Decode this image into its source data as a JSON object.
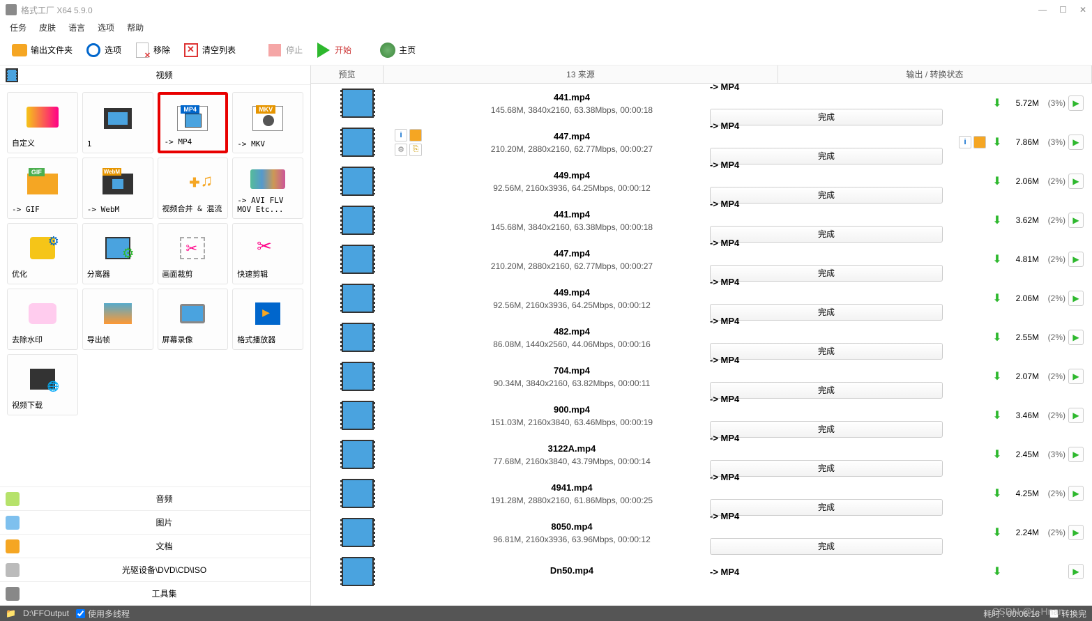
{
  "window": {
    "title": "格式工厂 X64 5.9.0"
  },
  "menu": [
    "任务",
    "皮肤",
    "语言",
    "选项",
    "帮助"
  ],
  "toolbar": {
    "output": "输出文件夹",
    "options": "选项",
    "remove": "移除",
    "clear": "清空列表",
    "stop": "停止",
    "start": "开始",
    "home": "主页"
  },
  "left": {
    "video_header": "视频",
    "tiles": [
      {
        "id": "custom",
        "label": "自定义",
        "art": "art-custom"
      },
      {
        "id": "clap",
        "label": "1",
        "art": "art-clap"
      },
      {
        "id": "mp4",
        "label": "-> MP4",
        "art": "art-mp4",
        "highlight": true
      },
      {
        "id": "mkv",
        "label": "-> MKV",
        "art": "art-mkv"
      },
      {
        "id": "gif",
        "label": "-> GIF",
        "art": "art-gif"
      },
      {
        "id": "webm",
        "label": "-> WebM",
        "art": "art-webm"
      },
      {
        "id": "merge",
        "label": "视频合并 & 混流",
        "art": "art-merge"
      },
      {
        "id": "blank1",
        "label": "",
        "art": "",
        "hidden": true
      },
      {
        "id": "avi",
        "label": "-> AVI FLV MOV Etc...",
        "art": "art-avi"
      },
      {
        "id": "opt",
        "label": "优化",
        "art": "art-opt"
      },
      {
        "id": "split",
        "label": "分离器",
        "art": "art-split"
      },
      {
        "id": "crop",
        "label": "画面裁剪",
        "art": "art-crop"
      },
      {
        "id": "cut",
        "label": "快速剪辑",
        "art": "art-cut"
      },
      {
        "id": "logo",
        "label": "去除水印",
        "art": "art-logo"
      },
      {
        "id": "export",
        "label": "导出帧",
        "art": "art-export"
      },
      {
        "id": "screen",
        "label": "屏幕录像",
        "art": "art-screen"
      },
      {
        "id": "player",
        "label": "格式播放器",
        "art": "art-player"
      },
      {
        "id": "dl",
        "label": "视频下载",
        "art": "art-dl"
      }
    ],
    "bottom": [
      {
        "id": "audio",
        "label": "音频",
        "color": "#b6e26b"
      },
      {
        "id": "image",
        "label": "图片",
        "color": "#7ec0ee"
      },
      {
        "id": "doc",
        "label": "文档",
        "color": "#f5a623"
      },
      {
        "id": "disc",
        "label": "光驱设备\\DVD\\CD\\ISO",
        "color": "#bbb"
      },
      {
        "id": "tools",
        "label": "工具集",
        "color": "#888"
      }
    ]
  },
  "list": {
    "headers": {
      "preview": "预览",
      "source": "13 来源",
      "status": "输出 / 转换状态"
    },
    "done_label": "完成",
    "rows": [
      {
        "name": "441.mp4",
        "info": "145.68M, 3840x2160, 63.38Mbps, 00:00:18",
        "out": "-> MP4",
        "size": "5.72M",
        "pct": "(3%)"
      },
      {
        "name": "447.mp4",
        "info": "210.20M, 2880x2160, 62.77Mbps, 00:00:27",
        "out": "-> MP4",
        "size": "7.86M",
        "pct": "(3%)",
        "badges": true,
        "extra": true
      },
      {
        "name": "449.mp4",
        "info": "92.56M, 2160x3936, 64.25Mbps, 00:00:12",
        "out": "-> MP4",
        "size": "2.06M",
        "pct": "(2%)"
      },
      {
        "name": "441.mp4",
        "info": "145.68M, 3840x2160, 63.38Mbps, 00:00:18",
        "out": "-> MP4",
        "size": "3.62M",
        "pct": "(2%)"
      },
      {
        "name": "447.mp4",
        "info": "210.20M, 2880x2160, 62.77Mbps, 00:00:27",
        "out": "-> MP4",
        "size": "4.81M",
        "pct": "(2%)"
      },
      {
        "name": "449.mp4",
        "info": "92.56M, 2160x3936, 64.25Mbps, 00:00:12",
        "out": "-> MP4",
        "size": "2.06M",
        "pct": "(2%)"
      },
      {
        "name": "482.mp4",
        "info": "86.08M, 1440x2560, 44.06Mbps, 00:00:16",
        "out": "-> MP4",
        "size": "2.55M",
        "pct": "(2%)"
      },
      {
        "name": "704.mp4",
        "info": "90.34M, 3840x2160, 63.82Mbps, 00:00:11",
        "out": "-> MP4",
        "size": "2.07M",
        "pct": "(2%)"
      },
      {
        "name": "900.mp4",
        "info": "151.03M, 2160x3840, 63.46Mbps, 00:00:19",
        "out": "-> MP4",
        "size": "3.46M",
        "pct": "(2%)"
      },
      {
        "name": "3122A.mp4",
        "info": "77.68M, 2160x3840, 43.79Mbps, 00:00:14",
        "out": "-> MP4",
        "size": "2.45M",
        "pct": "(3%)"
      },
      {
        "name": "4941.mp4",
        "info": "191.28M, 2880x2160, 61.86Mbps, 00:00:25",
        "out": "-> MP4",
        "size": "4.25M",
        "pct": "(2%)"
      },
      {
        "name": "8050.mp4",
        "info": "96.81M, 2160x3936, 63.96Mbps, 00:00:12",
        "out": "-> MP4",
        "size": "2.24M",
        "pct": "(2%)"
      },
      {
        "name": "Dn50.mp4",
        "info": "",
        "out": "-> MP4",
        "size": "",
        "pct": "",
        "partial": true
      }
    ]
  },
  "status": {
    "output_path": "D:\\FFOutput",
    "multithread": "使用多线程",
    "elapsed_label": "耗时 :",
    "elapsed": "00:06:16",
    "after_label": "转换完",
    "watermark": "CSDN @L-Hnan"
  }
}
